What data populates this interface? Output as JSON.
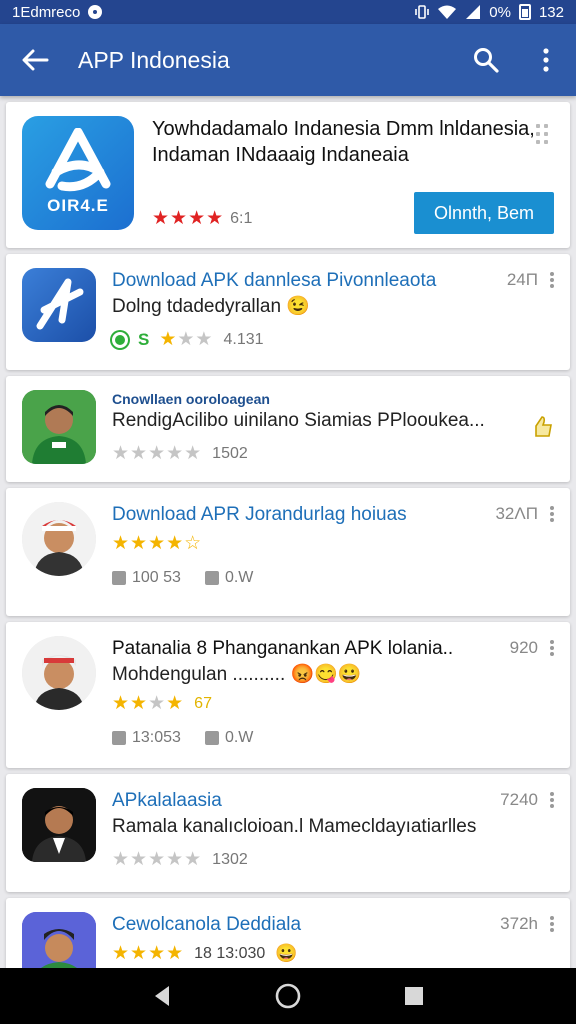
{
  "status_bar": {
    "time": "1Edmreco",
    "right_text": "0%",
    "clock": "132"
  },
  "app_bar": {
    "title": "APP Indonesia"
  },
  "featured": {
    "icon_caption": "OIR4.E",
    "title": "Yowhdadamalo Indanesia Dmm lnldanesia, Indaman INdaaaig Indaneaia",
    "rating_text": "6:1",
    "button_label": "Olnnth, Bem"
  },
  "items": [
    {
      "name": "Download APK dannlesa Pivonnleaota",
      "desc": "Dolng tdadedyrallan 😉",
      "meta": "24Π",
      "rating_text": "4.131",
      "badge": "S"
    },
    {
      "name_small": "Cnowllaen ooroloagean",
      "desc": "RendigAcilibo uinilano Siamias PPlooukea...",
      "rating_text": "1502"
    },
    {
      "name": "Download APR Jorandurlag hoiuas",
      "meta": "32ΛΠ",
      "stat1": "100 53",
      "stat2": "0.W"
    },
    {
      "name": "Patanalia 8 Phanganankan APK lolania..",
      "desc": "Mohdengulan ..........",
      "meta": "920",
      "rating_text": "67",
      "stat1": "13:053",
      "stat2": "0.W"
    },
    {
      "name": "APkalalaasia",
      "desc": "Ramala kanalıcloioan.l Mamecldayıatiarlles",
      "meta": "7240",
      "rating_text": "1302"
    },
    {
      "name": "Cewolcanola Deddiala",
      "meta": "372h",
      "rating_text": "18 13:030"
    }
  ],
  "colors": {
    "primary": "#2f5aa8",
    "status": "#24458f",
    "link": "#1e6fb8",
    "button": "#1a8fd1"
  }
}
